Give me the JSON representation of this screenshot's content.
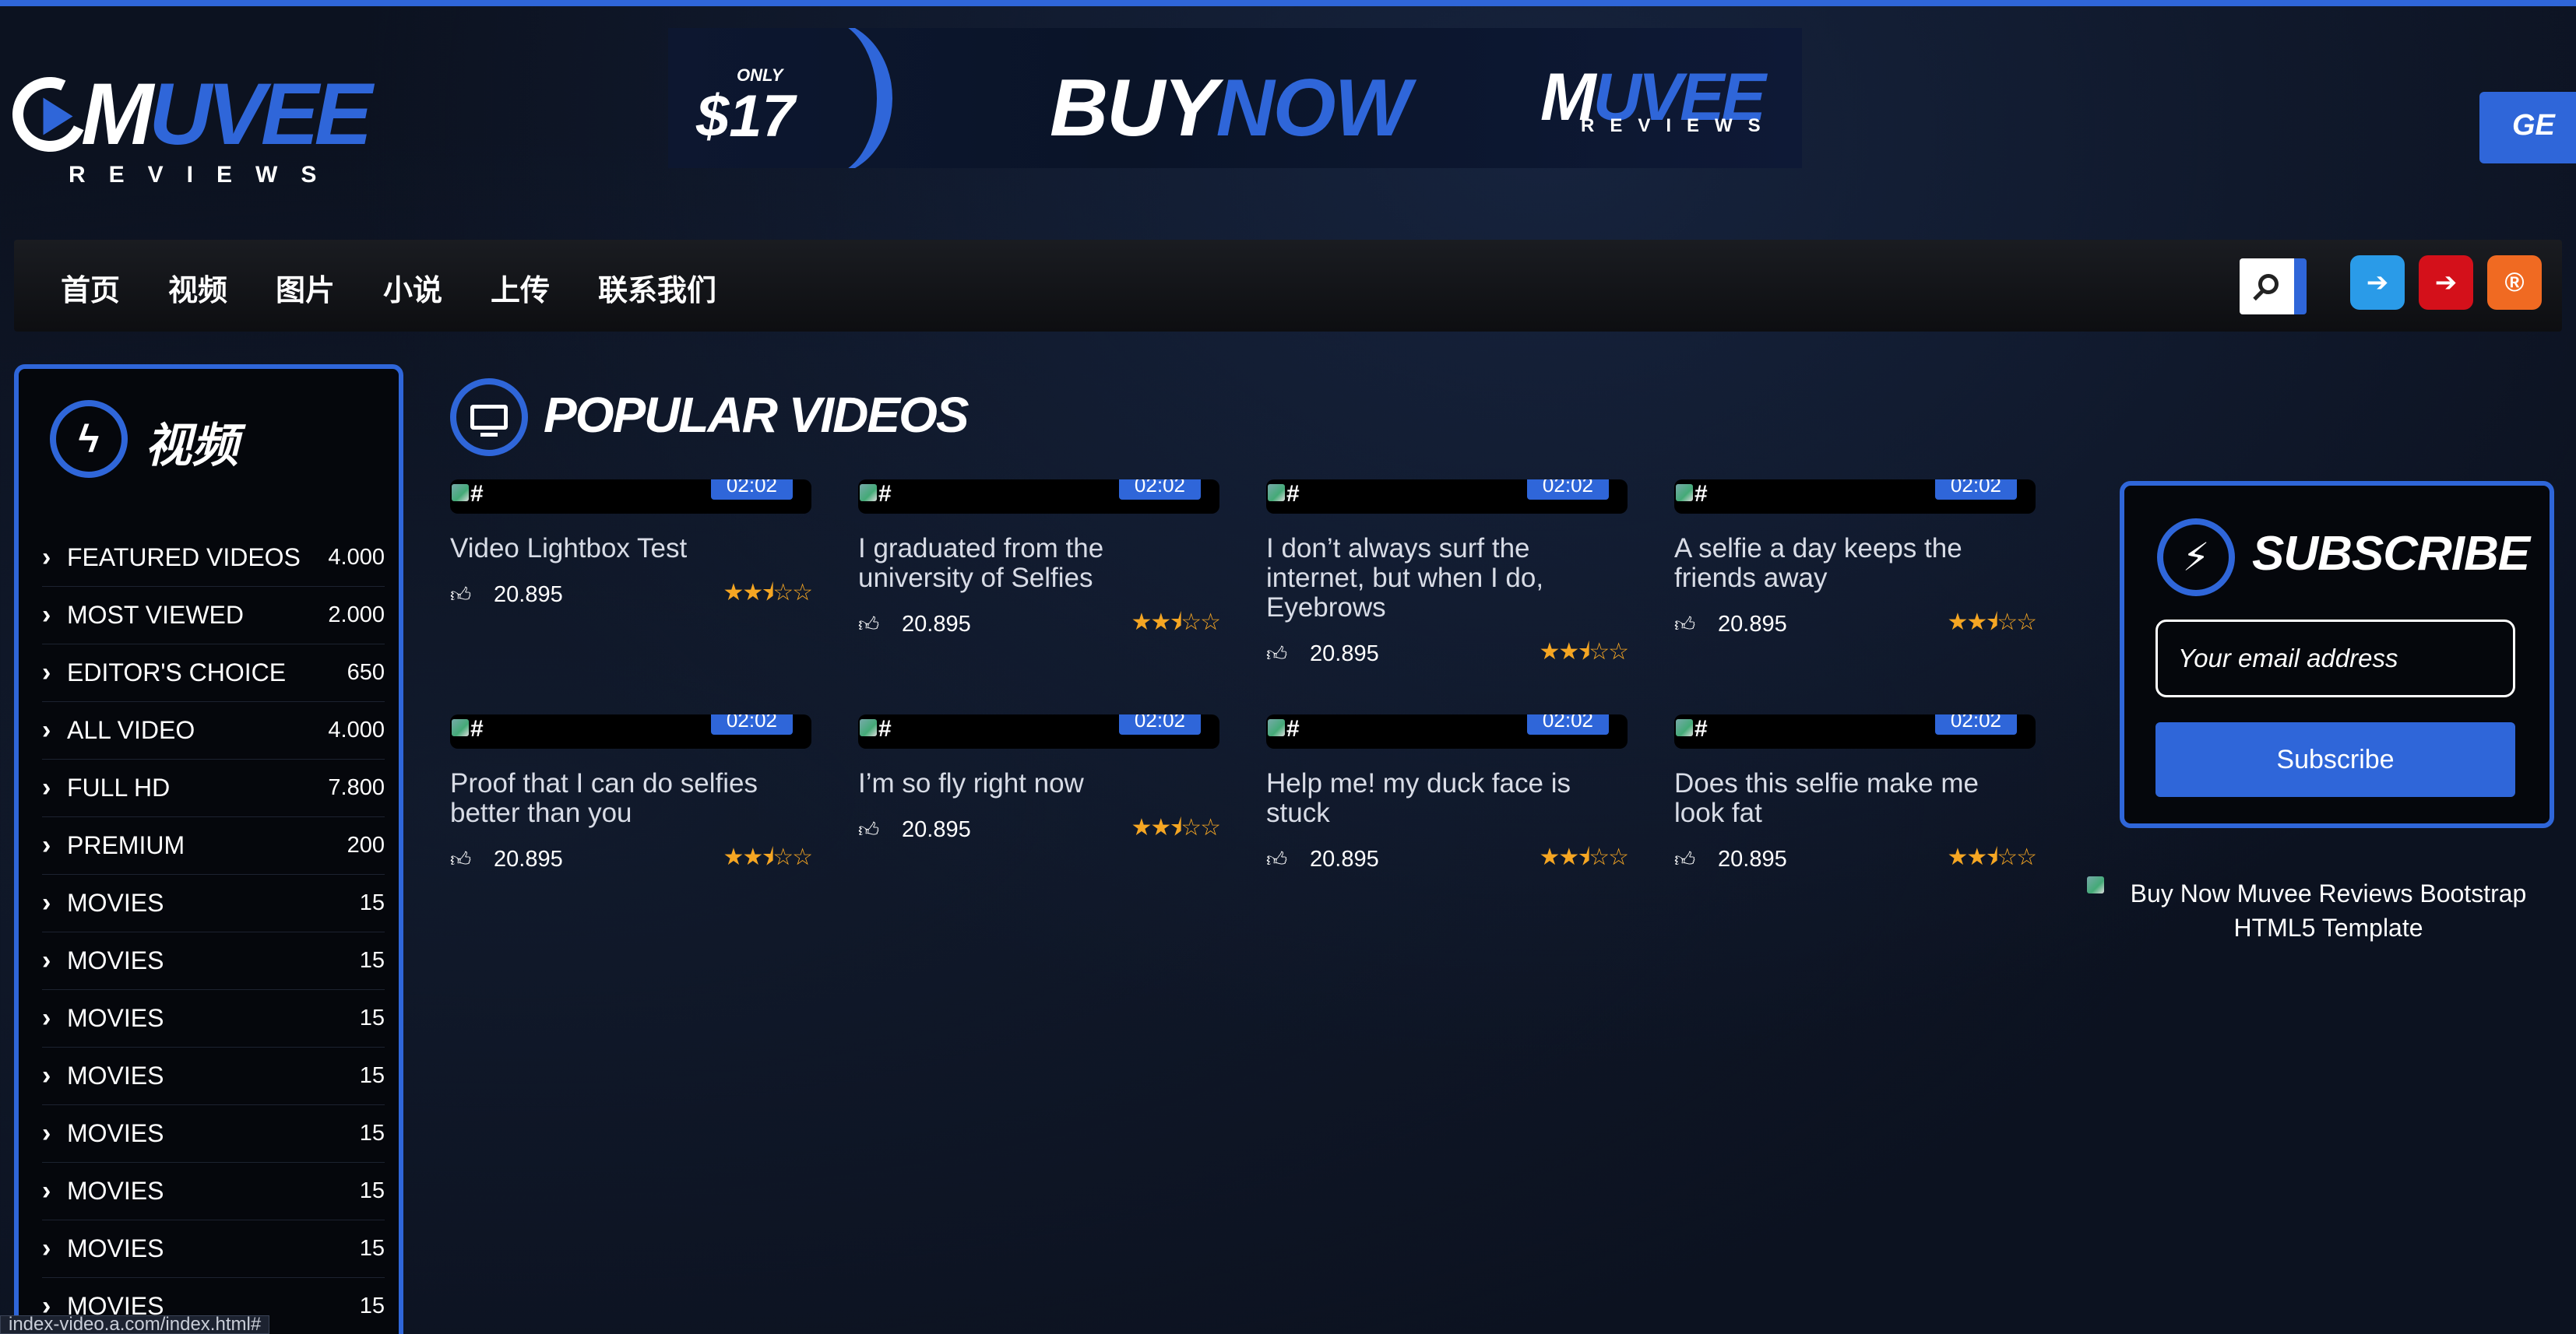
{
  "header": {
    "logo_main": "MUVEE",
    "logo_sub": "REVIEWS",
    "banner": {
      "only": "ONLY",
      "price": "$17",
      "buy": "BUY",
      "now": "NOW",
      "logo_main": "MUVEE",
      "logo_sub": "REVIEWS"
    },
    "get_button": "GE"
  },
  "nav": {
    "items": [
      "首页",
      "视频",
      "图片",
      "小说",
      "上传",
      "联系我们"
    ],
    "icons": [
      "search-icon",
      "logout-icon",
      "login-icon",
      "register-icon"
    ],
    "register_glyph": "®",
    "colors": {
      "logout": "#2a9be8",
      "login": "#d4101a",
      "register": "#f06a22"
    }
  },
  "sidebar": {
    "title": "视频",
    "items": [
      {
        "label": "FEATURED VIDEOS",
        "count": "4.000"
      },
      {
        "label": "MOST VIEWED",
        "count": "2.000"
      },
      {
        "label": "EDITOR'S CHOICE",
        "count": "650"
      },
      {
        "label": "ALL VIDEO",
        "count": "4.000"
      },
      {
        "label": "FULL HD",
        "count": "7.800"
      },
      {
        "label": "PREMIUM",
        "count": "200"
      },
      {
        "label": "MOVIES",
        "count": "15"
      },
      {
        "label": "MOVIES",
        "count": "15"
      },
      {
        "label": "MOVIES",
        "count": "15"
      },
      {
        "label": "MOVIES",
        "count": "15"
      },
      {
        "label": "MOVIES",
        "count": "15"
      },
      {
        "label": "MOVIES",
        "count": "15"
      },
      {
        "label": "MOVIES",
        "count": "15"
      },
      {
        "label": "MOVIES",
        "count": "15"
      }
    ]
  },
  "main": {
    "title": "POPULAR VIDEOS",
    "videos": [
      {
        "title": "Video Lightbox Test",
        "duration": "02:02",
        "likes": "20.895",
        "thumb_alt": "#",
        "rating": 2.5
      },
      {
        "title": "I graduated from the university of Selfies",
        "duration": "02:02",
        "likes": "20.895",
        "thumb_alt": "#",
        "rating": 2.5
      },
      {
        "title": "I don’t always surf the internet, but when I do, Eyebrows",
        "duration": "02:02",
        "likes": "20.895",
        "thumb_alt": "#",
        "rating": 2.5
      },
      {
        "title": "A selfie a day keeps the friends away",
        "duration": "02:02",
        "likes": "20.895",
        "thumb_alt": "#",
        "rating": 2.5
      },
      {
        "title": "Proof that I can do selfies better than you",
        "duration": "02:02",
        "likes": "20.895",
        "thumb_alt": "#",
        "rating": 2.5
      },
      {
        "title": "I’m so fly right now",
        "duration": "02:02",
        "likes": "20.895",
        "thumb_alt": "#",
        "rating": 2.5
      },
      {
        "title": "Help me! my duck face is stuck",
        "duration": "02:02",
        "likes": "20.895",
        "thumb_alt": "#",
        "rating": 2.5
      },
      {
        "title": "Does this selfie make me look fat",
        "duration": "02:02",
        "likes": "20.895",
        "thumb_alt": "#",
        "rating": 2.5
      }
    ]
  },
  "subscribe": {
    "title": "SUBSCRIBE",
    "email_placeholder": "Your email address",
    "button_label": "Subscribe"
  },
  "side_ad": {
    "alt_text": "Buy Now Muvee Reviews Bootstrap HTML5 Template"
  },
  "status_bar": {
    "url": "index-video.a.com/index.html#"
  },
  "colors": {
    "accent": "#2f66d9",
    "star": "#f5a623",
    "background": "#0c1220"
  }
}
